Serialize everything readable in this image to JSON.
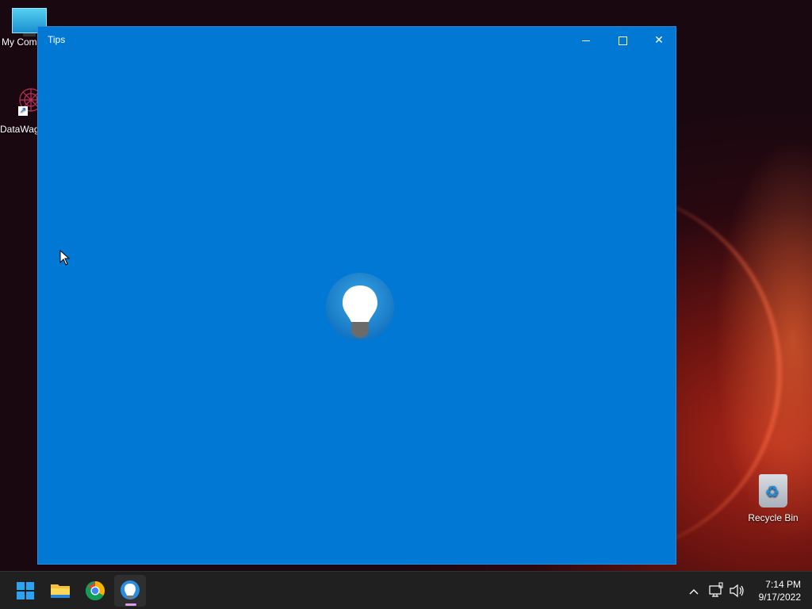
{
  "desktop": {
    "icons": [
      {
        "label": "My Com",
        "icon": "computer-icon"
      },
      {
        "label": "DataWag",
        "icon": "datawagon-icon"
      },
      {
        "label": "Recycle Bin",
        "icon": "recycle-bin-icon"
      }
    ]
  },
  "window": {
    "title": "Tips",
    "splash_icon": "lightbulb-icon",
    "accent": "#0078d4",
    "controls": {
      "minimize": "minimize-icon",
      "maximize": "maximize-icon",
      "close": "close-icon"
    }
  },
  "taskbar": {
    "apps": [
      {
        "name": "start",
        "icon": "windows-start-icon"
      },
      {
        "name": "file-explorer",
        "icon": "folder-icon"
      },
      {
        "name": "chrome",
        "icon": "chrome-icon"
      },
      {
        "name": "tips",
        "icon": "lightbulb-icon",
        "active": true
      }
    ],
    "tray": {
      "chevron": "chevron-up-icon",
      "network": "network-icon",
      "volume": "speaker-icon"
    },
    "clock": {
      "time": "7:14 PM",
      "date": "9/17/2022"
    }
  }
}
